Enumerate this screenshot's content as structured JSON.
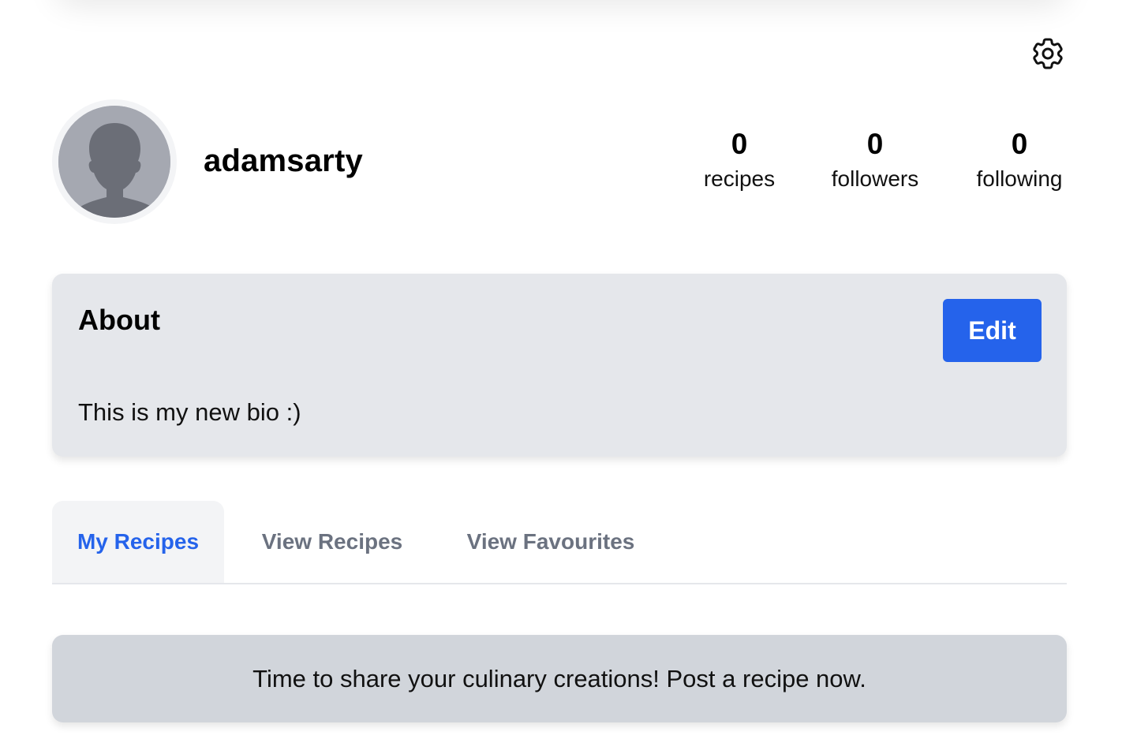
{
  "profile": {
    "username": "adamsarty",
    "avatar_icon": "default-user-silhouette-icon",
    "stats": {
      "recipes": {
        "count": "0",
        "label": "recipes"
      },
      "followers": {
        "count": "0",
        "label": "followers"
      },
      "following": {
        "count": "0",
        "label": "following"
      }
    }
  },
  "settings": {
    "icon": "gear-icon"
  },
  "about": {
    "title": "About",
    "edit_label": "Edit",
    "bio": "This is my new bio :)"
  },
  "tabs": [
    {
      "label": "My Recipes",
      "active": true
    },
    {
      "label": "View Recipes",
      "active": false
    },
    {
      "label": "View Favourites",
      "active": false
    }
  ],
  "empty_state": {
    "message": "Time to share your culinary creations! Post a recipe now."
  },
  "colors": {
    "accent": "#2563eb",
    "card_bg": "#e5e7eb",
    "banner_bg": "#d1d5db",
    "tab_inactive": "#6b7280"
  }
}
